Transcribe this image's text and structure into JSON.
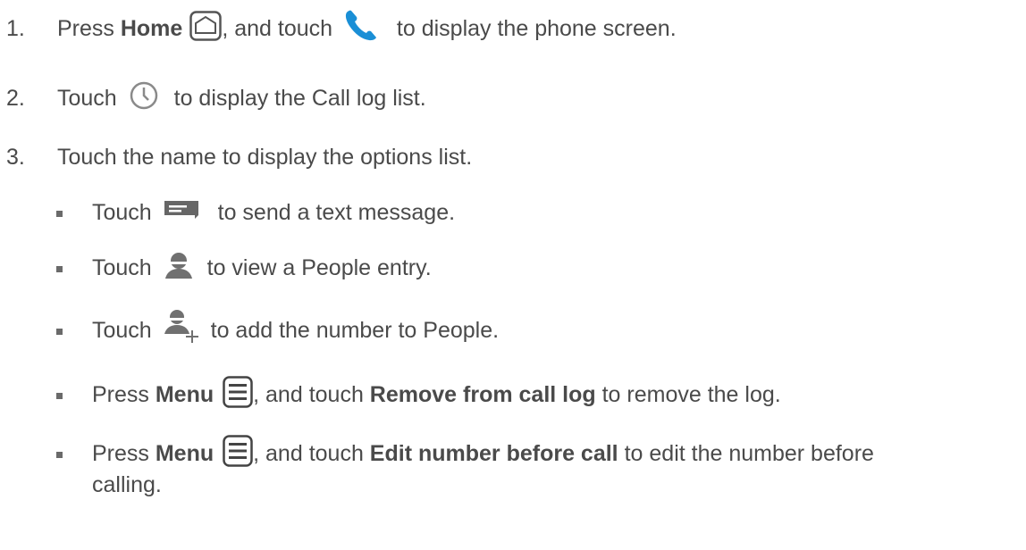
{
  "steps": [
    {
      "num": "1.",
      "a": "Press ",
      "b": "Home",
      "c": ", and touch ",
      "d": " to display the phone screen."
    },
    {
      "num": "2.",
      "a": "Touch ",
      "b": " to display the Call log list."
    },
    {
      "num": "3.",
      "a": "Touch the name to display the options list."
    }
  ],
  "subs": [
    {
      "a": "Touch ",
      "b": " to send a text message."
    },
    {
      "a": "Touch ",
      "b": " to view a People entry."
    },
    {
      "a": "Touch ",
      "b": " to add the number to People."
    },
    {
      "a": "Press ",
      "b": "Menu",
      "c": ", and touch ",
      "d": "Remove from call log",
      "e": " to remove the log."
    },
    {
      "a": "Press ",
      "b": "Menu",
      "c": ", and touch ",
      "d": "Edit number before call",
      "e": " to edit the number before",
      "f": "calling."
    }
  ],
  "icons": {
    "home": "home-key-icon",
    "phone": "phone-icon",
    "clock": "call-log-clock-icon",
    "message": "text-message-icon",
    "person": "people-icon",
    "person_add": "add-to-people-icon",
    "menu": "menu-key-icon"
  },
  "colors": {
    "text": "#4a4a4a",
    "phone_blue": "#1a8fd6",
    "icon_gray": "#6d6d6d"
  }
}
